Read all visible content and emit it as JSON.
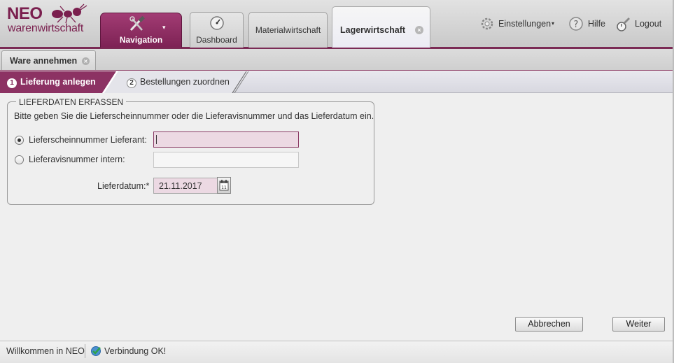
{
  "app": {
    "logo_top": "NEO",
    "logo_sub_a": "waren",
    "logo_sub_b": "wirtschaft"
  },
  "header": {
    "nav_label": "Navigation",
    "tabs": [
      {
        "label": "Dashboard"
      },
      {
        "label": "Materialwirtschaft"
      },
      {
        "label": "Lagerwirtschaft",
        "active": true
      }
    ],
    "settings_label": "Einstellungen",
    "help_label": "Hilfe",
    "logout_label": "Logout"
  },
  "subtabs": [
    {
      "label": "Ware annehmen"
    }
  ],
  "wizard": {
    "steps": [
      {
        "num": "1",
        "label": "Lieferung anlegen",
        "active": true
      },
      {
        "num": "2",
        "label": "Bestellungen zuordnen",
        "active": false
      }
    ]
  },
  "form": {
    "legend": "LIEFERDATEN ERFASSEN",
    "hint": "Bitte geben Sie die Lieferscheinnummer oder die Lieferavisnummer und das Lieferdatum ein.",
    "option1_label": "Lieferscheinnummer Lieferant:",
    "option1_value": "",
    "option2_label": "Lieferavisnummer intern:",
    "option2_value": "",
    "date_label": "Lieferdatum:*",
    "date_value": "21.11.2017",
    "selected_option": "option1"
  },
  "buttons": {
    "cancel_label": "Abbrechen",
    "next_label": "Weiter"
  },
  "statusbar": {
    "welcome": "Willkommen in NEO",
    "connection": "Verbindung OK!"
  },
  "colors": {
    "accent": "#7d2254",
    "input_focus_bg": "#ecd9e3"
  }
}
